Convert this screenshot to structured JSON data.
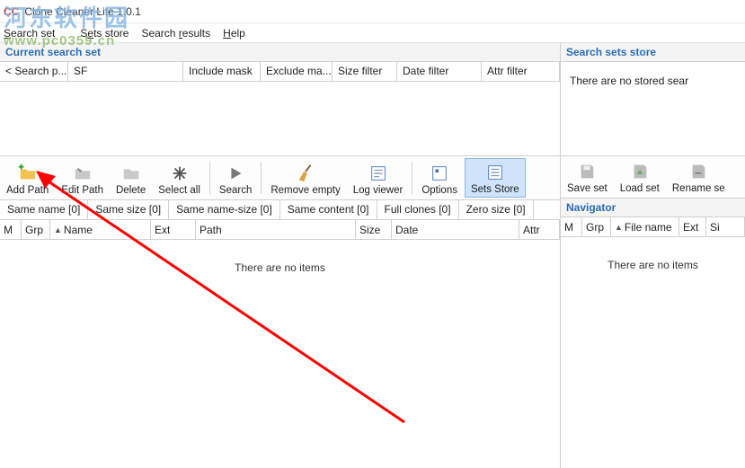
{
  "window": {
    "icon_text": "CC",
    "title": "Clone Cleaner Lite 1.0.1"
  },
  "menu": {
    "search_set": "Search set",
    "sets_store": "Sets store",
    "search_results": "Search results",
    "help": "Help"
  },
  "left": {
    "current_head": "Current search set",
    "cols": {
      "sp": "< Search p...",
      "sf": "SF",
      "incmask": "Include mask",
      "excmask": "Exclude ma...",
      "sizef": "Size filter",
      "datef": "Date filter",
      "attrf": "Attr filter"
    },
    "toolbar": {
      "addpath": "Add Path",
      "editpath": "Edit Path",
      "delete": "Delete",
      "selectall": "Select all",
      "search": "Search",
      "removeempty": "Remove empty",
      "logviewer": "Log viewer",
      "options": "Options",
      "setsstore": "Sets Store"
    },
    "tabs": {
      "samename": "Same name [0]",
      "samesize": "Same size [0]",
      "samenamesize": "Same name-size [0]",
      "samecontent": "Same content [0]",
      "fullclones": "Full clones [0]",
      "zerosize": "Zero size [0]"
    },
    "list": {
      "m": "M",
      "grp": "Grp",
      "name": "Name",
      "ext": "Ext",
      "path": "Path",
      "size": "Size",
      "date": "Date",
      "attr": "Attr"
    },
    "empty": "There are no items"
  },
  "right": {
    "store_head": "Search sets store",
    "nostored": "There are no stored sear",
    "toolbar": {
      "saveset": "Save set",
      "loadset": "Load set",
      "renameset": "Rename se"
    },
    "nav_head": "Navigator",
    "list": {
      "m": "M",
      "grp": "Grp",
      "filename": "File name",
      "ext": "Ext",
      "si": "Si"
    },
    "empty": "There are no items"
  },
  "watermark": {
    "cn": "河东软件园",
    "url": "www.pc0359.cn"
  }
}
